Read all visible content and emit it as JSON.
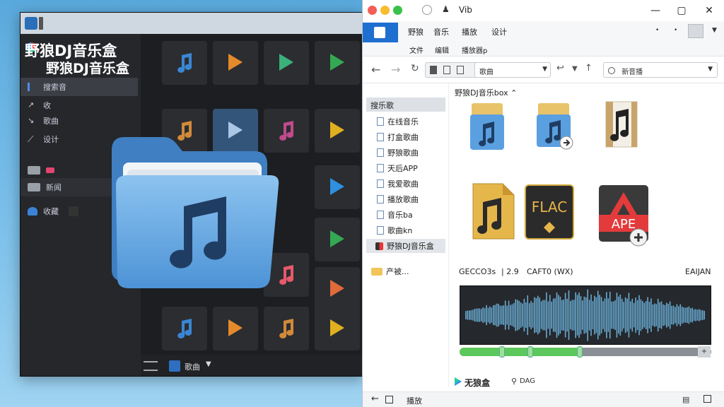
{
  "dark_app": {
    "brand_line1": "野狼DJ音乐盒",
    "brand_line2": "野狼DJ音乐盒",
    "sidebar": [
      {
        "icon": "folder-list-icon",
        "label": "搜索音"
      },
      {
        "icon": "arrow-icon",
        "label": "收"
      },
      {
        "icon": "arrow-icon",
        "label": "歌曲"
      },
      {
        "icon": "pulse-icon",
        "label": "设计"
      },
      {
        "icon": "folder-icon",
        "label": ""
      },
      {
        "icon": "inbox-icon",
        "label": "新闻"
      },
      {
        "icon": "user-icon",
        "label": "收藏"
      }
    ],
    "bottom_label": "歌曲"
  },
  "explorer": {
    "title": "Vib",
    "ribbon_tabs": [
      "野狼",
      "音乐",
      "播放",
      "设计"
    ],
    "ribbon_sub": [
      "文件",
      "编辑",
      "播放器p"
    ],
    "address": "歌曲",
    "search_placeholder": "新音播",
    "nav_header": "搜乐歌",
    "nav_items": [
      "在线音乐",
      "打盒歌曲",
      "野狼歌曲",
      "天后APP",
      "我爱歌曲",
      "播放歌曲",
      "音乐ba",
      "歌曲kn"
    ],
    "nav_selected": "野狼DJ音乐盒",
    "nav_other": "产被...",
    "pane_title": "野狼DJ音乐box",
    "files": [
      {
        "type": "folder-music"
      },
      {
        "type": "folder-music-shortcut"
      },
      {
        "type": "music-doc"
      },
      {
        "type": "music-file",
        "label": ""
      },
      {
        "type": "flac",
        "label": "FLAC"
      },
      {
        "type": "ape",
        "label": "APE"
      }
    ],
    "info_left": "GECCO3s",
    "info_mid": "| 2.9",
    "info_codec": "CAFT0 (WX)",
    "info_right": "EAIJAN",
    "footer_brand": "无狼盒",
    "footer_loc": "DAG",
    "status_label": "播放",
    "progress": 0.48
  },
  "colors": {
    "accent": "#1f6fd1",
    "folder": "#5aa0e0",
    "wave": "#6aaed6",
    "progress": "#5cc85c"
  }
}
